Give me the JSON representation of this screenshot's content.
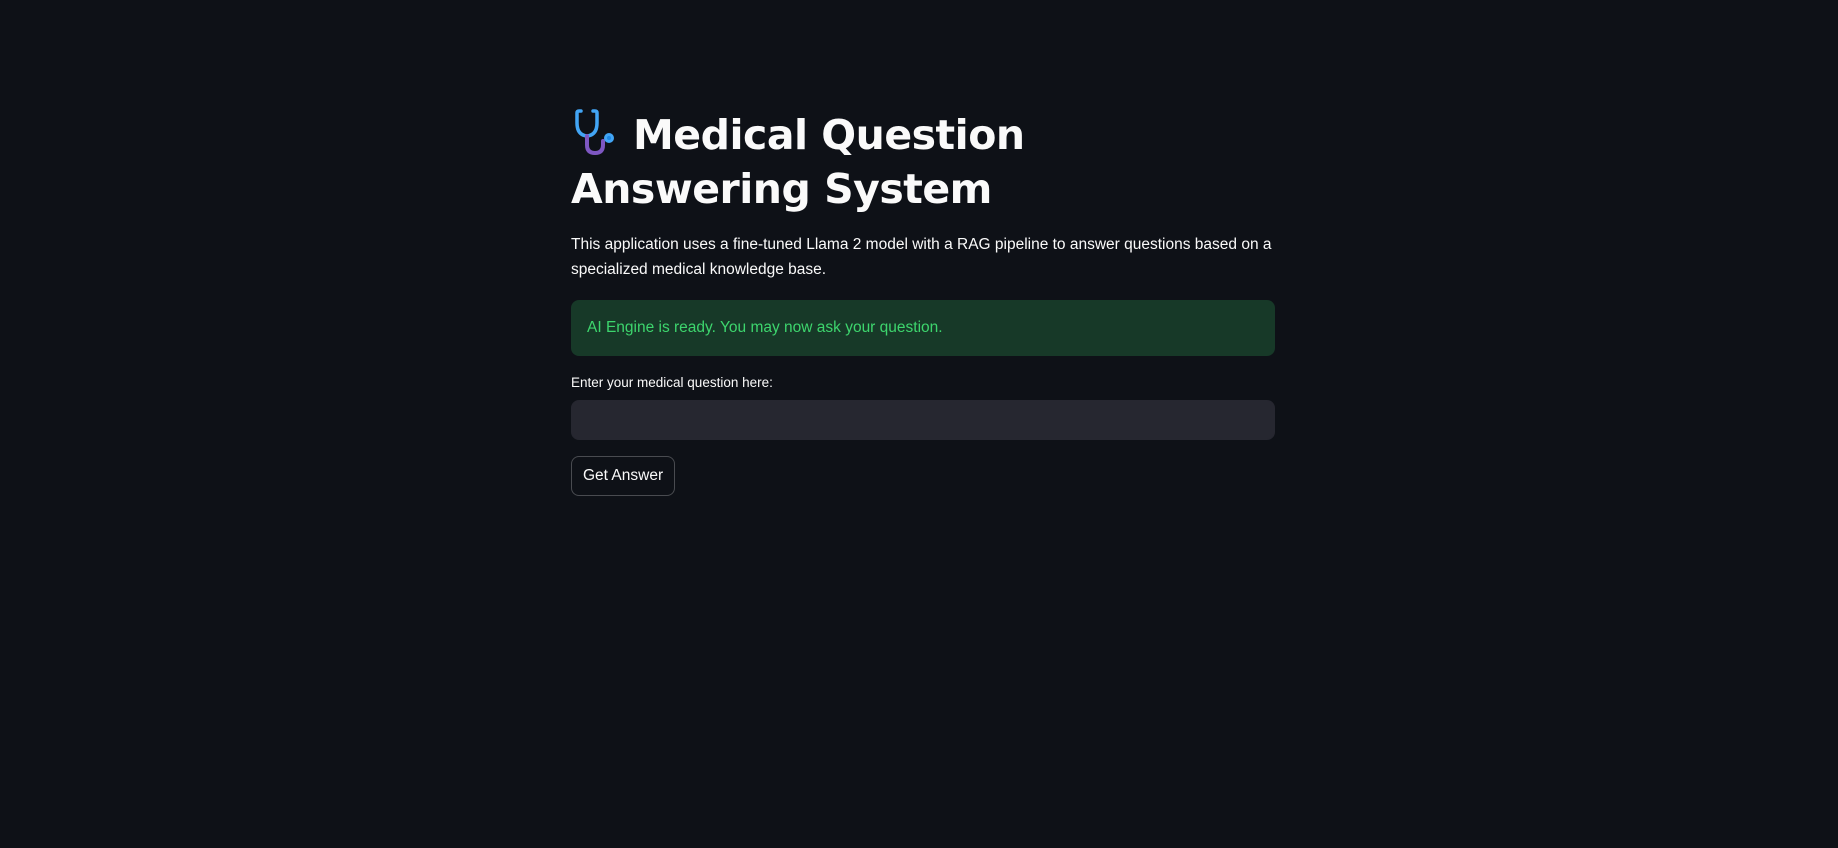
{
  "header": {
    "icon": "stethoscope-icon",
    "title": "Medical Question Answering System"
  },
  "description": "This application uses a fine-tuned Llama 2 model with a RAG pipeline to answer questions based on a specialized medical knowledge base.",
  "status": {
    "message": "AI Engine is ready. You may now ask your question.",
    "type": "success"
  },
  "question_input": {
    "label": "Enter your medical question here:",
    "value": "",
    "placeholder": ""
  },
  "submit_button": {
    "label": "Get Answer"
  },
  "colors": {
    "background": "#0e1117",
    "success_bg": "#173928",
    "success_text": "#3dd56d",
    "input_bg": "#262730"
  }
}
